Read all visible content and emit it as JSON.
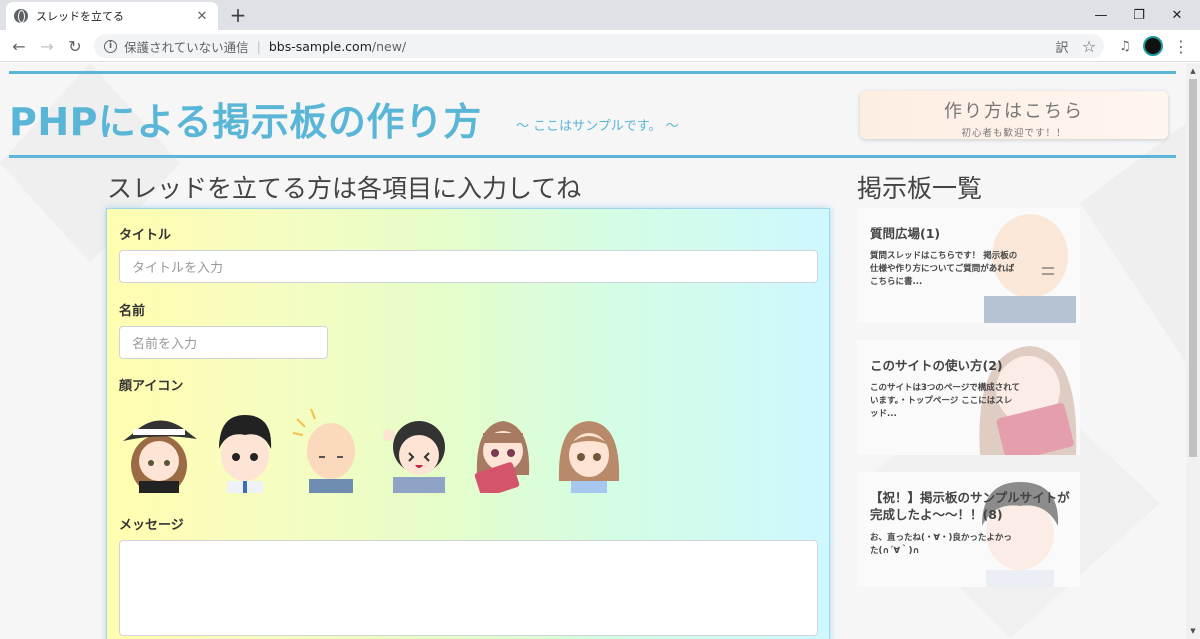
{
  "browser": {
    "tab_title": "スレッドを立てる",
    "tab_close": "✕",
    "new_tab": "+",
    "win_min": "—",
    "win_restore": "❐",
    "win_close": "✕",
    "back": "←",
    "forward": "→",
    "reload": "↻",
    "security_label": "保護されていない通信",
    "separator": "|",
    "url_host": "bbs-sample.com",
    "url_path": "/new/",
    "translate": "訳",
    "bookmark": "☆",
    "media": "♫",
    "menu": "⋮",
    "accent": "#5ab6d6"
  },
  "header": {
    "title": "PHPによる掲示板の作り方",
    "subtitle": "～ ここはサンプルです。 ～",
    "howto_title": "作り方はこちら",
    "howto_sub": "初心者も歓迎です！！"
  },
  "form": {
    "heading": "スレッドを立てる方は各項目に入力してね",
    "title_label": "タイトル",
    "title_placeholder": "タイトルを入力",
    "name_label": "名前",
    "name_placeholder": "名前を入力",
    "icon_label": "顔アイコン",
    "message_label": "メッセージ",
    "icons": [
      "hat-girl-face-icon",
      "boy-face-icon",
      "bald-man-face-icon",
      "laughing-girl-face-icon",
      "book-girl-face-icon",
      "smiling-girl-face-icon"
    ]
  },
  "boards": {
    "heading": "掲示板一覧",
    "items": [
      {
        "title": "質問広場(1)",
        "excerpt": "質問スレッドはこちらです！ 掲示板の仕様や作り方についてご質問があればこちらに書..."
      },
      {
        "title": "このサイトの使い方(2)",
        "excerpt": "このサイトは3つのページで構成されています。・トップページ ここにはスレッド..."
      },
      {
        "title": "【祝！】掲示板のサンプルサイトが完成したよ～～！！(8)",
        "excerpt": "お、直ったね(・∀・)良かったよかった(∩´∀｀)∩"
      }
    ]
  }
}
